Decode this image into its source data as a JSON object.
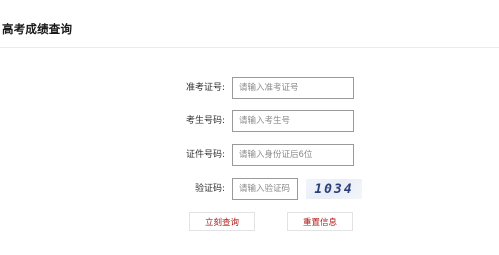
{
  "header": {
    "title": "高考成绩查询"
  },
  "form": {
    "exam_number": {
      "label": "准考证号:",
      "placeholder": "请输入准考证号",
      "value": ""
    },
    "candidate_number": {
      "label": "考生号码:",
      "placeholder": "请输入考生号",
      "value": ""
    },
    "id_number": {
      "label": "证件号码:",
      "placeholder": "请输入身份证后6位",
      "value": ""
    },
    "captcha": {
      "label": "验证码:",
      "placeholder": "请输入验证码",
      "value": "",
      "image_text": "1034"
    }
  },
  "buttons": {
    "query_label": "立刻查询",
    "reset_label": "重置信息"
  },
  "colors": {
    "button_text": "#b01a1a",
    "input_border": "#9a9a9a"
  }
}
